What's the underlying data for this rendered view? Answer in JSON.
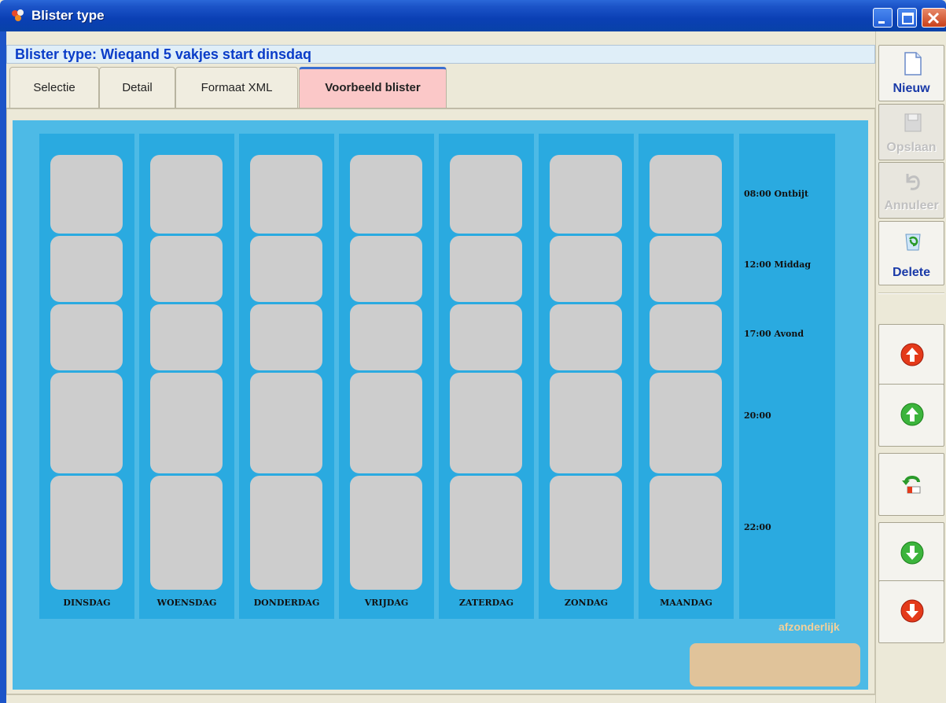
{
  "window": {
    "title": "Blister type",
    "header": "Blister type: Wieqand 5 vakjes start dinsdaq"
  },
  "tabs": [
    {
      "label": "Selectie"
    },
    {
      "label": "Detail"
    },
    {
      "label": "Formaat XML"
    },
    {
      "label": "Voorbeeld blister",
      "active": true
    }
  ],
  "blister": {
    "days": [
      "DINSDAG",
      "WOENSDAG",
      "DONDERDAG",
      "VRIJDAG",
      "ZATERDAG",
      "ZONDAG",
      "MAANDAG"
    ],
    "times": [
      "08:00 Ontbijt",
      "12:00 Middag",
      "17:00 Avond",
      "20:00",
      "22:00"
    ],
    "separate_label": "afzonderlijk"
  },
  "toolbar": {
    "new_label": "Nieuw",
    "save_label": "Opslaan",
    "cancel_label": "Annuleer",
    "delete_label": "Delete"
  },
  "colors": {
    "panel": "#4dbae6",
    "column": "#2aaae0",
    "cell": "#cdcdcd",
    "active_tab": "#fbc8c8",
    "header_text": "#0a3cc8",
    "separate_box": "#e0c39a"
  },
  "icons": {
    "move_up_red": "arrow-up-red-icon",
    "move_up_green": "arrow-up-green-icon",
    "undo": "undo-icon",
    "move_down_green": "arrow-down-green-icon",
    "move_down_red": "arrow-down-red-icon"
  }
}
